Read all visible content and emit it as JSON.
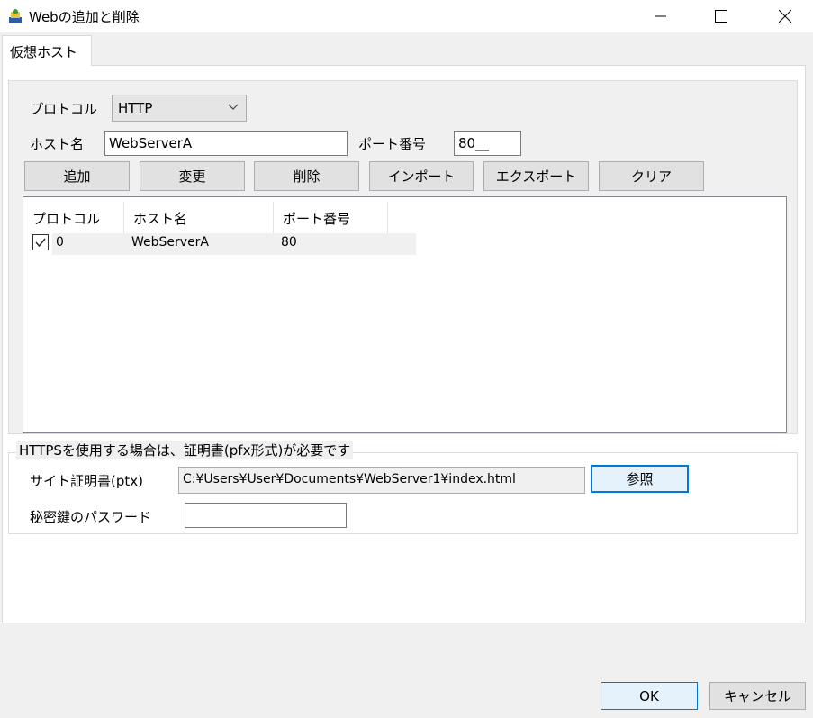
{
  "window": {
    "title": "Webの追加と削除"
  },
  "tabs": [
    {
      "label": "仮想ホスト"
    }
  ],
  "form": {
    "protocol_label": "プロトコル",
    "protocol_value": "HTTP",
    "host_label": "ホスト名",
    "host_value": "WebServerA",
    "port_label": "ポート番号",
    "port_value": "80__"
  },
  "buttons": {
    "add": "追加",
    "change": "変更",
    "delete": "削除",
    "import": "インポート",
    "export": "エクスポート",
    "clear": "クリア"
  },
  "list": {
    "columns": [
      "プロトコル",
      "ホスト名",
      "ポート番号"
    ],
    "rows": [
      {
        "checked": true,
        "protocol": "0",
        "host": "WebServerA",
        "port": "80"
      }
    ]
  },
  "https": {
    "caption": "HTTPSを使用する場合は、証明書(pfx形式)が必要です",
    "cert_label": "サイト証明書(ptx)",
    "cert_value": "C:¥Users¥User¥Documents¥WebServer1¥index.html",
    "browse_label": "参照",
    "password_label": "秘密鍵のパスワード",
    "password_value": ""
  },
  "dialog": {
    "ok": "OK",
    "cancel": "キャンセル"
  }
}
